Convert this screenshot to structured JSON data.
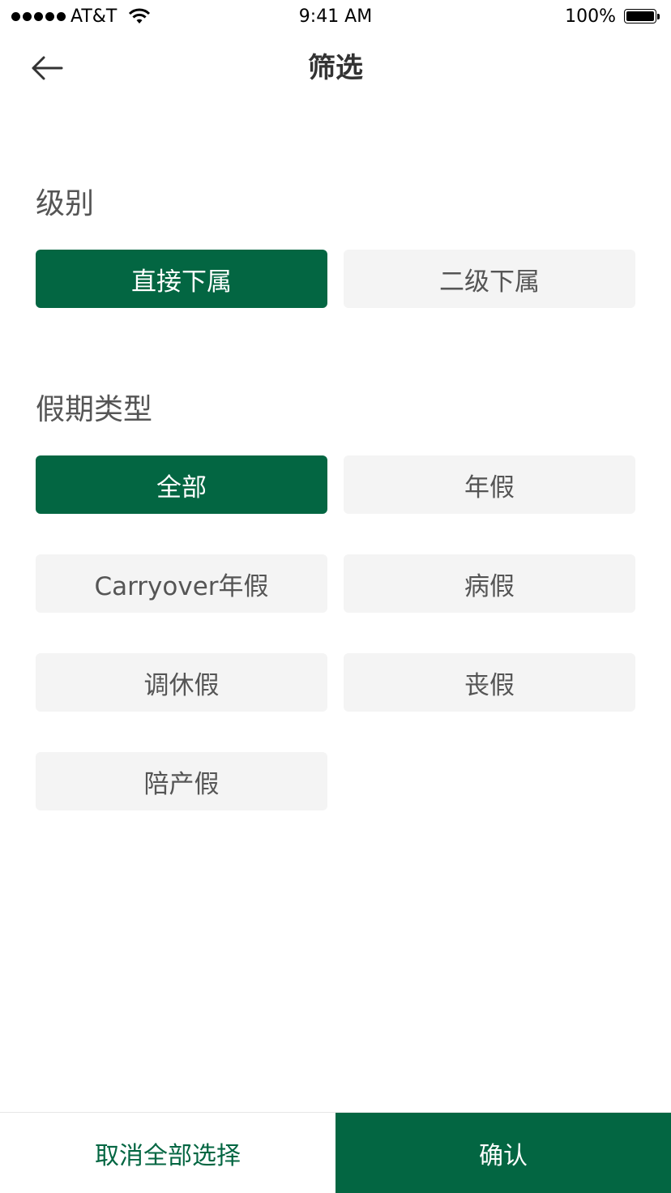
{
  "status_bar": {
    "carrier": "AT&T",
    "time": "9:41 AM",
    "battery": "100%",
    "battery_level": 1.0,
    "signal_icon": "signal-dots-icon",
    "wifi_icon": "wifi-icon",
    "battery_icon": "battery-icon"
  },
  "nav": {
    "title": "筛选",
    "back_icon": "arrow-left-icon"
  },
  "level_section": {
    "title": "级别",
    "options": [
      {
        "label": "直接下属",
        "selected": true
      },
      {
        "label": "二级下属",
        "selected": false
      }
    ]
  },
  "leave_type_section": {
    "title": "假期类型",
    "options": [
      {
        "label": "全部",
        "selected": true
      },
      {
        "label": "年假",
        "selected": false
      },
      {
        "label": "Carryover年假",
        "selected": false
      },
      {
        "label": "病假",
        "selected": false
      },
      {
        "label": "调休假",
        "selected": false
      },
      {
        "label": "丧假",
        "selected": false
      },
      {
        "label": "陪产假",
        "selected": false
      }
    ]
  },
  "footer": {
    "clear_label": "取消全部选择",
    "confirm_label": "确认"
  },
  "colors": {
    "accent": "#036642",
    "chip_bg": "#f4f4f4",
    "text": "#333333",
    "muted_text": "#555555"
  }
}
